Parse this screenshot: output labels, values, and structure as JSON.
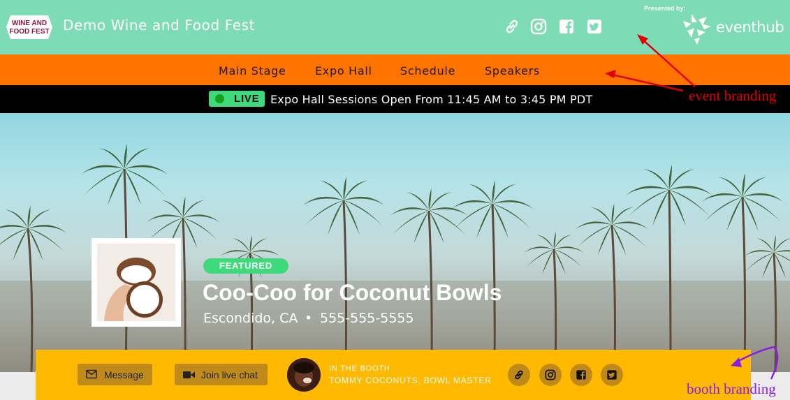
{
  "header": {
    "logo_text_line1": "WINE AND",
    "logo_text_line2": "FOOD FEST",
    "event_title": "Demo Wine and Food Fest",
    "social_icons": [
      "link-icon",
      "instagram-icon",
      "facebook-icon",
      "twitter-icon"
    ],
    "presented_by": "Presented by:",
    "sponsor_name": "eventhub",
    "colors": {
      "background": "#7ddcb6"
    }
  },
  "nav": {
    "items": [
      {
        "label": "Main Stage"
      },
      {
        "label": "Expo Hall"
      },
      {
        "label": "Schedule"
      },
      {
        "label": "Speakers"
      }
    ],
    "colors": {
      "background": "#ff7300"
    }
  },
  "live_bar": {
    "badge": "LIVE",
    "message": "Expo Hall Sessions Open From 11:45 AM to 3:45 PM PDT",
    "colors": {
      "badge": "#3dd97a"
    }
  },
  "booth": {
    "featured_badge": "FEATURED",
    "name": "Coo-Coo for Coconut Bowls",
    "location": "Escondido, CA",
    "separator": "•",
    "phone": "555-555-5555",
    "message_label": "Message",
    "live_chat_label": "Join live chat",
    "in_booth_label": "IN THE BOOTH",
    "in_booth_name": "TOMMY COCONUTS, BOWL MASTER",
    "social_icons": [
      "link-icon",
      "instagram-icon",
      "facebook-icon",
      "twitter-icon"
    ],
    "colors": {
      "bar": "#ffb900",
      "buttons": "#c08a1a"
    }
  },
  "annotations": {
    "event_branding": "event branding",
    "booth_branding": "booth branding",
    "colors": {
      "event": "#e00000",
      "booth": "#8a1ee6"
    }
  }
}
